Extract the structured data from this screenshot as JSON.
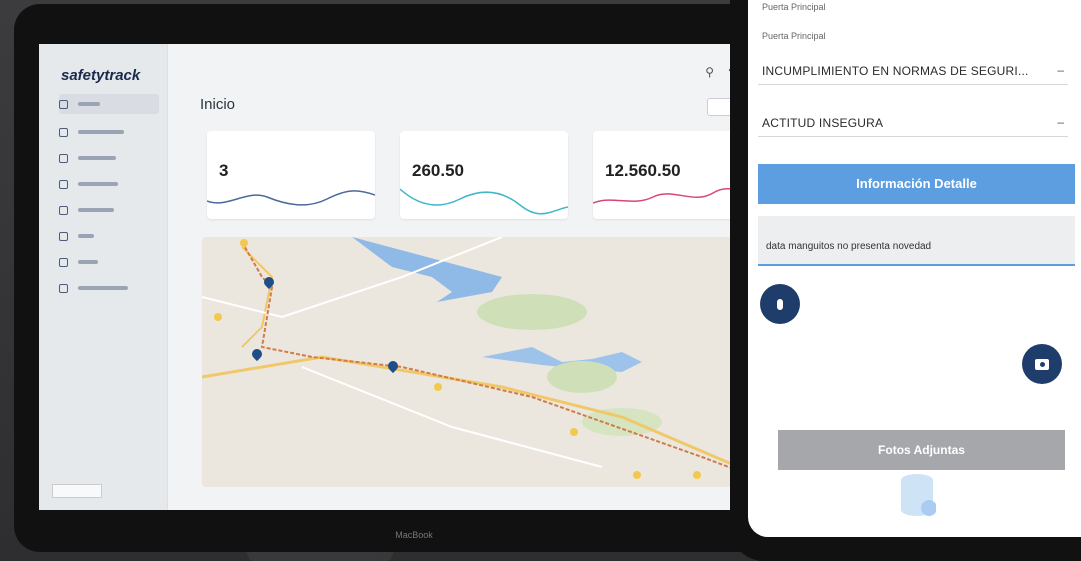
{
  "laptop": {
    "app": {
      "logo": "safetytrack"
    },
    "sidebar": {
      "items": [
        {
          "label": "",
          "active": true
        },
        {
          "label": ""
        },
        {
          "label": ""
        },
        {
          "label": ""
        },
        {
          "label": ""
        },
        {
          "label": ""
        },
        {
          "label": ""
        },
        {
          "label": ""
        }
      ],
      "footer": ""
    },
    "page_title": "Inicio",
    "date_button": "",
    "cards": [
      {
        "title": "",
        "value": "3"
      },
      {
        "title": "",
        "value": "260.50"
      },
      {
        "title": "",
        "value": "12.560.50"
      }
    ],
    "brand": "MacBook"
  },
  "phone": {
    "field1_value": "Puerta Principal",
    "field2_label": "",
    "field2_value": "Puerta Principal",
    "field3_label": "",
    "select1": "INCUMPLIMIENTO EN NORMAS DE SEGURI...",
    "select2_label": "",
    "select2": "ACTITUD INSEGURA",
    "section_title": "Información Detalle",
    "obs_label": "",
    "obs_value": "data manguitos no presenta novedad",
    "audio_hint": "",
    "photo_hint": "",
    "photo_note": "",
    "photos_title": "Fotos Adjuntas",
    "colors": {
      "accent": "#5d9ee0",
      "dark": "#1f3d6b",
      "gray_bar": "#a5a7aa"
    }
  }
}
